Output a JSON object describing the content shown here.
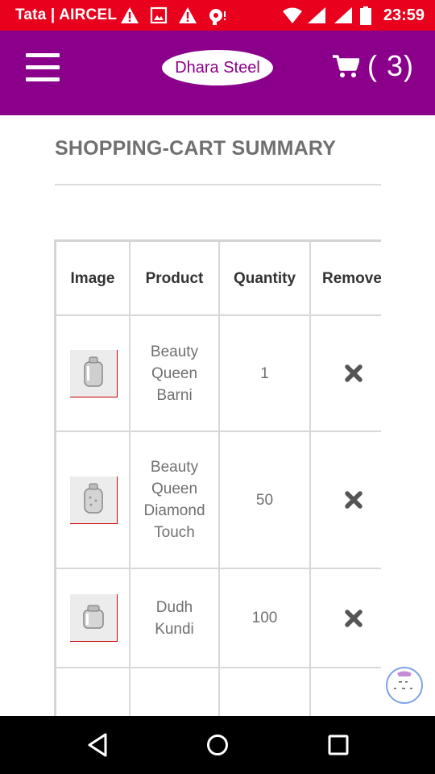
{
  "status_bar": {
    "carrier": "Tata | AIRCEL",
    "time": "23:59",
    "icons": [
      "warning-icon",
      "image-icon",
      "warning-icon",
      "vpn-icon",
      "wifi-icon",
      "signal-icon",
      "signal-icon",
      "battery-icon"
    ]
  },
  "header": {
    "logo_text": "Dhara Steel",
    "cart_count": "( 3)",
    "brand_color": "#8b008b"
  },
  "page": {
    "title": "SHOPPING-CART SUMMARY"
  },
  "cart_table": {
    "columns": [
      "Image",
      "Product",
      "Quantity",
      "Remove"
    ],
    "rows": [
      {
        "product": "Beauty Queen Barni",
        "quantity": "1"
      },
      {
        "product": "Beauty Queen Diamond Touch",
        "quantity": "50"
      },
      {
        "product": "Dudh Kundi",
        "quantity": "100"
      }
    ]
  },
  "colors": {
    "status_bar": "#e8001c",
    "header": "#8b008b"
  }
}
